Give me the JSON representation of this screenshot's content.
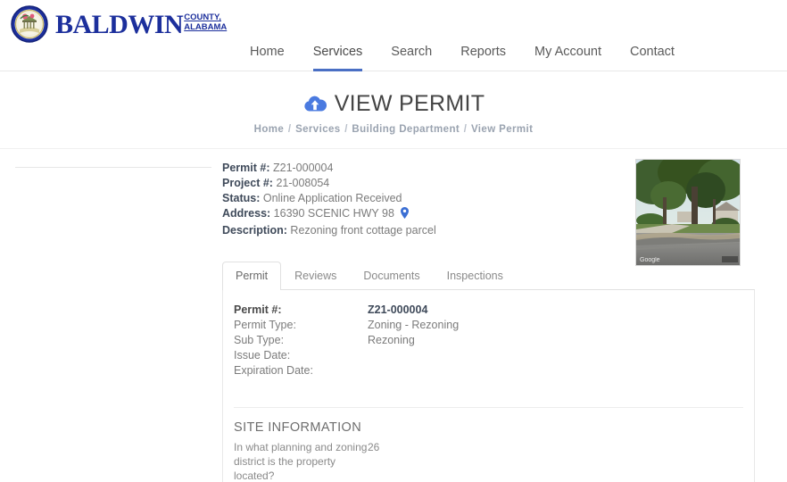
{
  "header": {
    "logo": {
      "seal_icon": "county-seal-icon",
      "main_text": "BALDWIN",
      "sub_line1": "COUNTY,",
      "sub_line2": "ALABAMA"
    },
    "nav": [
      {
        "label": "Home",
        "active": false
      },
      {
        "label": "Services",
        "active": true
      },
      {
        "label": "Search",
        "active": false
      },
      {
        "label": "Reports",
        "active": false
      },
      {
        "label": "My Account",
        "active": false
      },
      {
        "label": "Contact",
        "active": false
      }
    ]
  },
  "title": {
    "icon": "cloud-upload-icon",
    "text": "VIEW PERMIT",
    "breadcrumb": [
      "Home",
      "Services",
      "Building Department",
      "View Permit"
    ],
    "breadcrumb_separator": "/"
  },
  "details": {
    "permit_label": "Permit #:",
    "permit_value": "Z21-000004",
    "project_label": "Project #:",
    "project_value": "21-008054",
    "status_label": "Status:",
    "status_value": "Online Application Received",
    "address_label": "Address:",
    "address_value": "16390 SCENIC HWY 98",
    "address_icon": "map-pin-icon",
    "description_label": "Description:",
    "description_value": "Rezoning front cottage parcel"
  },
  "thumbnail": {
    "name": "street-view-thumbnail",
    "attribution": "Google"
  },
  "tabs": [
    {
      "label": "Permit",
      "active": true
    },
    {
      "label": "Reviews",
      "active": false
    },
    {
      "label": "Documents",
      "active": false
    },
    {
      "label": "Inspections",
      "active": false
    }
  ],
  "permit_tab": {
    "fields": [
      {
        "key": "Permit #:",
        "value": "Z21-000004",
        "bold": true
      },
      {
        "key": "Permit Type:",
        "value": "Zoning - Rezoning",
        "bold": false
      },
      {
        "key": "Sub Type:",
        "value": "Rezoning",
        "bold": false
      },
      {
        "key": "Issue Date:",
        "value": "",
        "bold": false
      },
      {
        "key": "Expiration Date:",
        "value": "",
        "bold": false
      }
    ],
    "site_information": {
      "title": "SITE INFORMATION",
      "question": "In what planning and zoning district is the property located?",
      "answer": "26"
    }
  },
  "colors": {
    "brand_blue": "#1c2f9c",
    "accent_blue": "#4a6fc4",
    "icon_blue": "#4a7ae0",
    "text_gray": "#7b7b7b",
    "border_gray": "#e8e8e8"
  }
}
